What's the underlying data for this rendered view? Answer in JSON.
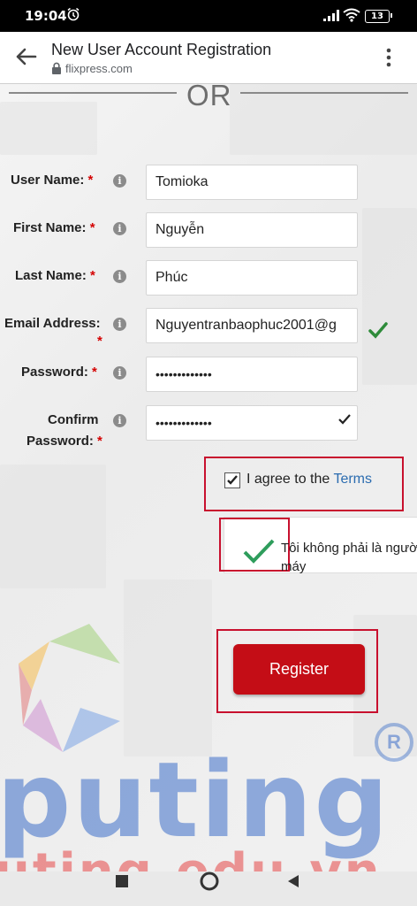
{
  "status_bar": {
    "time": "19:04",
    "battery": "13"
  },
  "header": {
    "title": "New User Account Registration",
    "domain": "flixpress.com"
  },
  "divider": {
    "text": "OR"
  },
  "form": {
    "username": {
      "label": "User Name:",
      "value": "Tomioka"
    },
    "firstname": {
      "label": "First Name:",
      "value": "Nguyễn"
    },
    "lastname": {
      "label": "Last Name:",
      "value": "Phúc"
    },
    "email": {
      "label": "Email Address:",
      "value": "Nguyentranbaophuc2001@g"
    },
    "password": {
      "label": "Password:",
      "value": "•••••••••••••"
    },
    "confirm": {
      "label_line1": "Confirm",
      "label_line2": "Password:",
      "value": "•••••••••••••"
    },
    "required_mark": "*",
    "info_glyph": "i"
  },
  "terms": {
    "prefix": "I agree to the ",
    "link": "Terms",
    "checked": true
  },
  "recaptcha": {
    "text": "Tôi không phải là người máy"
  },
  "register_button": {
    "label": "Register"
  },
  "watermark": {
    "text": "puting",
    "url": "uting.edu.vn",
    "reg": "R"
  },
  "colors": {
    "accent": "#c40d16",
    "link": "#2b6cb0",
    "check": "#2e8b3a"
  }
}
